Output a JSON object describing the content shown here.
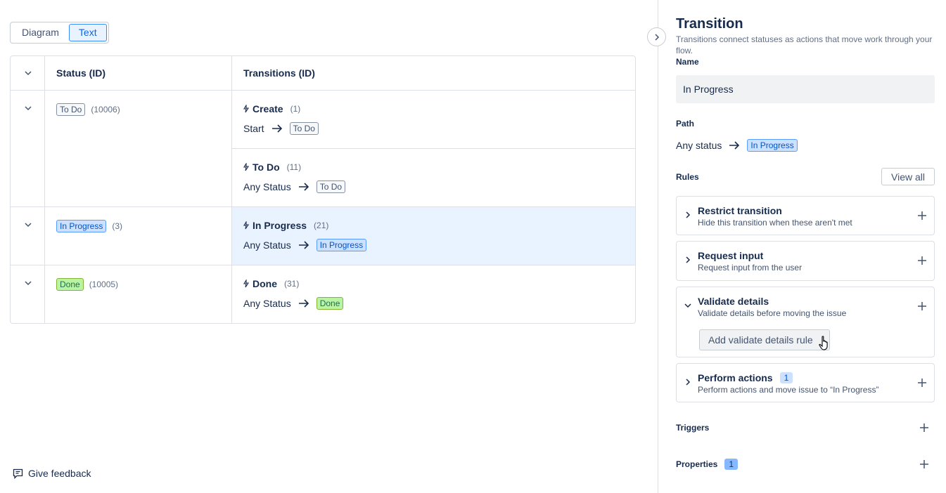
{
  "view_toggle": {
    "diagram": "Diagram",
    "text": "Text",
    "active": "Text"
  },
  "table": {
    "headers": {
      "status": "Status (ID)",
      "transitions": "Transitions (ID)"
    },
    "rows": [
      {
        "status": "To Do",
        "status_id": "(10006)",
        "status_color": "grey",
        "transitions": [
          {
            "name": "Create",
            "id": "(1)",
            "from": "Start",
            "to": "To Do",
            "to_color": "grey"
          },
          {
            "name": "To Do",
            "id": "(11)",
            "from": "Any Status",
            "to": "To Do",
            "to_color": "grey"
          }
        ]
      },
      {
        "status": "In Progress",
        "status_id": "(3)",
        "status_color": "blue",
        "transitions": [
          {
            "name": "In Progress",
            "id": "(21)",
            "from": "Any Status",
            "to": "In Progress",
            "to_color": "blue",
            "selected": true
          }
        ]
      },
      {
        "status": "Done",
        "status_id": "(10005)",
        "status_color": "green",
        "transitions": [
          {
            "name": "Done",
            "id": "(31)",
            "from": "Any Status",
            "to": "Done",
            "to_color": "green"
          }
        ]
      }
    ]
  },
  "feedback": {
    "label": "Give feedback"
  },
  "panel": {
    "title": "Transition",
    "description": "Transitions connect statuses as actions that move work through your flow.",
    "name_label": "Name",
    "name_value": "In Progress",
    "path_label": "Path",
    "path_from": "Any status",
    "path_to": "In Progress",
    "rules_label": "Rules",
    "view_all": "View all",
    "rules": [
      {
        "title": "Restrict transition",
        "subtitle": "Hide this transition when these aren't met",
        "expanded": false
      },
      {
        "title": "Request input",
        "subtitle": "Request input from the user",
        "expanded": false
      },
      {
        "title": "Validate details",
        "subtitle": "Validate details before moving the issue",
        "expanded": true,
        "button": "Add validate details rule"
      },
      {
        "title": "Perform actions",
        "subtitle": "Perform actions and move issue to “In Progress”",
        "expanded": false,
        "count": "1"
      }
    ],
    "triggers_label": "Triggers",
    "properties_label": "Properties",
    "properties_count": "1"
  },
  "colors": {
    "accent": "#0c66e4",
    "selected_row": "#e9f2ff",
    "border": "#dcdfe4"
  }
}
